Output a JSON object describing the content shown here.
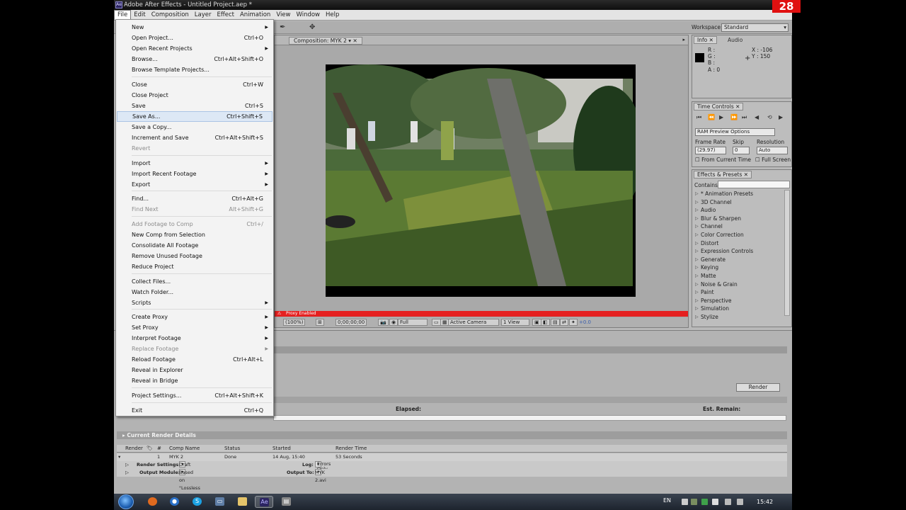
{
  "app": {
    "title": "Adobe After Effects - Untitled Project.aep *",
    "icon_text": "Ae",
    "recording_badge": "28"
  },
  "menubar": [
    "File",
    "Edit",
    "Composition",
    "Layer",
    "Effect",
    "Animation",
    "View",
    "Window",
    "Help"
  ],
  "toolbar": {
    "workspace_label": "Workspace:",
    "workspace_value": "Standard"
  },
  "file_menu": {
    "items": [
      {
        "label": "New",
        "shortcut": "",
        "submenu": true,
        "disabled": false
      },
      {
        "label": "Open Project...",
        "shortcut": "Ctrl+O",
        "submenu": false,
        "disabled": false
      },
      {
        "label": "Open Recent Projects",
        "shortcut": "",
        "submenu": true,
        "disabled": false
      },
      {
        "label": "Browse...",
        "shortcut": "Ctrl+Alt+Shift+O",
        "submenu": false,
        "disabled": false
      },
      {
        "label": "Browse Template Projects...",
        "shortcut": "",
        "submenu": false,
        "disabled": false
      },
      {
        "label": "Close",
        "shortcut": "Ctrl+W",
        "submenu": false,
        "disabled": false
      },
      {
        "label": "Close Project",
        "shortcut": "",
        "submenu": false,
        "disabled": false
      },
      {
        "label": "Save",
        "shortcut": "Ctrl+S",
        "submenu": false,
        "disabled": false
      },
      {
        "label": "Save As...",
        "shortcut": "Ctrl+Shift+S",
        "submenu": false,
        "disabled": false,
        "hover": true
      },
      {
        "label": "Save a Copy...",
        "shortcut": "",
        "submenu": false,
        "disabled": false
      },
      {
        "label": "Increment and Save",
        "shortcut": "Ctrl+Alt+Shift+S",
        "submenu": false,
        "disabled": false
      },
      {
        "label": "Revert",
        "shortcut": "",
        "submenu": false,
        "disabled": true
      },
      {
        "label": "Import",
        "shortcut": "",
        "submenu": true,
        "disabled": false
      },
      {
        "label": "Import Recent Footage",
        "shortcut": "",
        "submenu": true,
        "disabled": false
      },
      {
        "label": "Export",
        "shortcut": "",
        "submenu": true,
        "disabled": false
      },
      {
        "label": "Find...",
        "shortcut": "Ctrl+Alt+G",
        "submenu": false,
        "disabled": false
      },
      {
        "label": "Find Next",
        "shortcut": "Alt+Shift+G",
        "submenu": false,
        "disabled": true
      },
      {
        "label": "Add Footage to Comp",
        "shortcut": "Ctrl+/",
        "submenu": false,
        "disabled": true
      },
      {
        "label": "New Comp from Selection",
        "shortcut": "",
        "submenu": false,
        "disabled": false
      },
      {
        "label": "Consolidate All Footage",
        "shortcut": "",
        "submenu": false,
        "disabled": false
      },
      {
        "label": "Remove Unused Footage",
        "shortcut": "",
        "submenu": false,
        "disabled": false
      },
      {
        "label": "Reduce Project",
        "shortcut": "",
        "submenu": false,
        "disabled": false
      },
      {
        "label": "Collect Files...",
        "shortcut": "",
        "submenu": false,
        "disabled": false
      },
      {
        "label": "Watch Folder...",
        "shortcut": "",
        "submenu": false,
        "disabled": false
      },
      {
        "label": "Scripts",
        "shortcut": "",
        "submenu": true,
        "disabled": false
      },
      {
        "label": "Create Proxy",
        "shortcut": "",
        "submenu": true,
        "disabled": false
      },
      {
        "label": "Set Proxy",
        "shortcut": "",
        "submenu": true,
        "disabled": false
      },
      {
        "label": "Interpret Footage",
        "shortcut": "",
        "submenu": true,
        "disabled": false
      },
      {
        "label": "Replace Footage",
        "shortcut": "",
        "submenu": true,
        "disabled": true
      },
      {
        "label": "Reload Footage",
        "shortcut": "Ctrl+Alt+L",
        "submenu": false,
        "disabled": false
      },
      {
        "label": "Reveal in Explorer",
        "shortcut": "",
        "submenu": false,
        "disabled": false
      },
      {
        "label": "Reveal in Bridge",
        "shortcut": "",
        "submenu": false,
        "disabled": false
      },
      {
        "label": "Project Settings...",
        "shortcut": "Ctrl+Alt+Shift+K",
        "submenu": false,
        "disabled": false
      },
      {
        "label": "Exit",
        "shortcut": "Ctrl+Q",
        "submenu": false,
        "disabled": false
      }
    ]
  },
  "composition": {
    "tab_label": "Composition: MYK 2",
    "proxy_text": "Proxy Enabled",
    "magnification": "(100%)",
    "timecode": "0;00;00;00",
    "resolution": "Full",
    "camera": "Active Camera",
    "views": "1 View",
    "exposure": "+0.0"
  },
  "info_panel": {
    "tabs": [
      "Info",
      "Audio"
    ],
    "r": "R :",
    "g": "G :",
    "b": "B :",
    "a": "A : 0",
    "x": "X : -106",
    "y": "Y : 150"
  },
  "time_controls": {
    "tab": "Time Controls",
    "ram_preview": "RAM Preview Options",
    "frame_rate_label": "Frame Rate",
    "skip_label": "Skip",
    "resolution_label": "Resolution",
    "frame_rate_value": "(29.97)",
    "skip_value": "0",
    "resolution_value": "Auto",
    "from_current": "From Current Time",
    "full_screen": "Full Screen"
  },
  "effects_presets": {
    "tab": "Effects & Presets",
    "contains_label": "Contains:",
    "items": [
      "* Animation Presets",
      "3D Channel",
      "Audio",
      "Blur & Sharpen",
      "Channel",
      "Color Correction",
      "Distort",
      "Expression Controls",
      "Generate",
      "Keying",
      "Matte",
      "Noise & Grain",
      "Paint",
      "Perspective",
      "Simulation",
      "Stylize"
    ]
  },
  "render_queue": {
    "render_button": "Render",
    "elapsed_label": "Elapsed:",
    "est_remain_label": "Est. Remain:",
    "current_details": "Current Render Details",
    "columns": [
      "Render",
      "#",
      "Comp Name",
      "Status",
      "Started",
      "Render Time"
    ],
    "row": {
      "num": "1",
      "comp": "MYK 2",
      "status": "Done",
      "started": "14 Aug, 15:40",
      "render_time": "53 Seconds"
    },
    "render_settings_label": "Render Settings:",
    "render_settings_value": "Draft Settings",
    "log_label": "Log:",
    "log_value": "Errors Only",
    "output_module_label": "Output Module:",
    "output_module_value": "Based on \"Lossless with Alpha\"",
    "output_to_label": "Output To:",
    "output_to_value": "MYK 2.avi"
  },
  "taskbar": {
    "lang": "EN",
    "clock": "15:42"
  }
}
